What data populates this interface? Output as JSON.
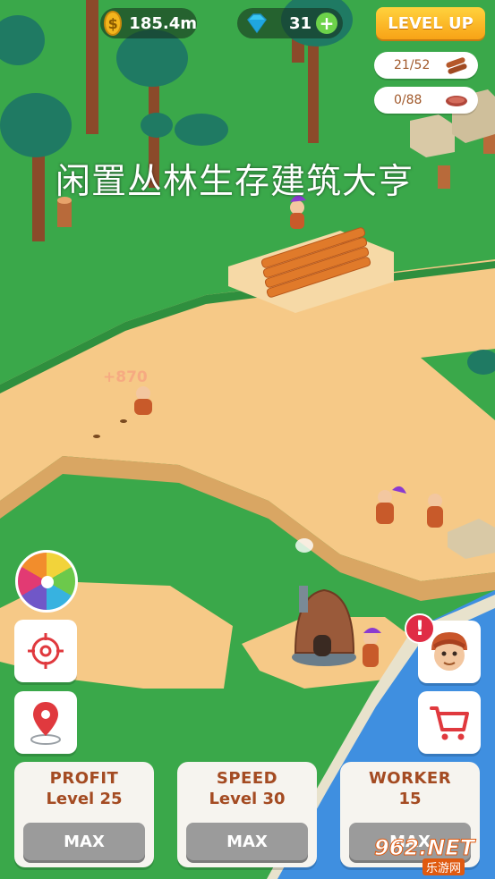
{
  "hud": {
    "coins": "185.4m",
    "gems": "31",
    "level_up_label": "LEVEL UP"
  },
  "resources": {
    "wood": "21/52",
    "meat": "0/88"
  },
  "overlay_title": "闲置丛林生存建筑大亨",
  "floating_reward": "+870",
  "upgrades": [
    {
      "title": "PROFIT",
      "level": "Level 25",
      "button": "MAX"
    },
    {
      "title": "SPEED",
      "level": "Level 30",
      "button": "MAX"
    },
    {
      "title": "WORKER",
      "level": "15",
      "button": "MAX"
    }
  ],
  "watermark": {
    "number": "962.NET",
    "caption": "乐游网"
  },
  "colors": {
    "grass": "#3aa84a",
    "sand": "#f6c987",
    "water": "#3f8fe0",
    "accent": "#f8a316"
  },
  "icons": [
    "coin-icon",
    "gem-icon",
    "plus-icon",
    "wood-icon",
    "meat-icon",
    "target-icon",
    "map-pin-icon",
    "cart-icon",
    "caveman-avatar-icon",
    "alert-icon",
    "fortune-wheel-icon"
  ]
}
